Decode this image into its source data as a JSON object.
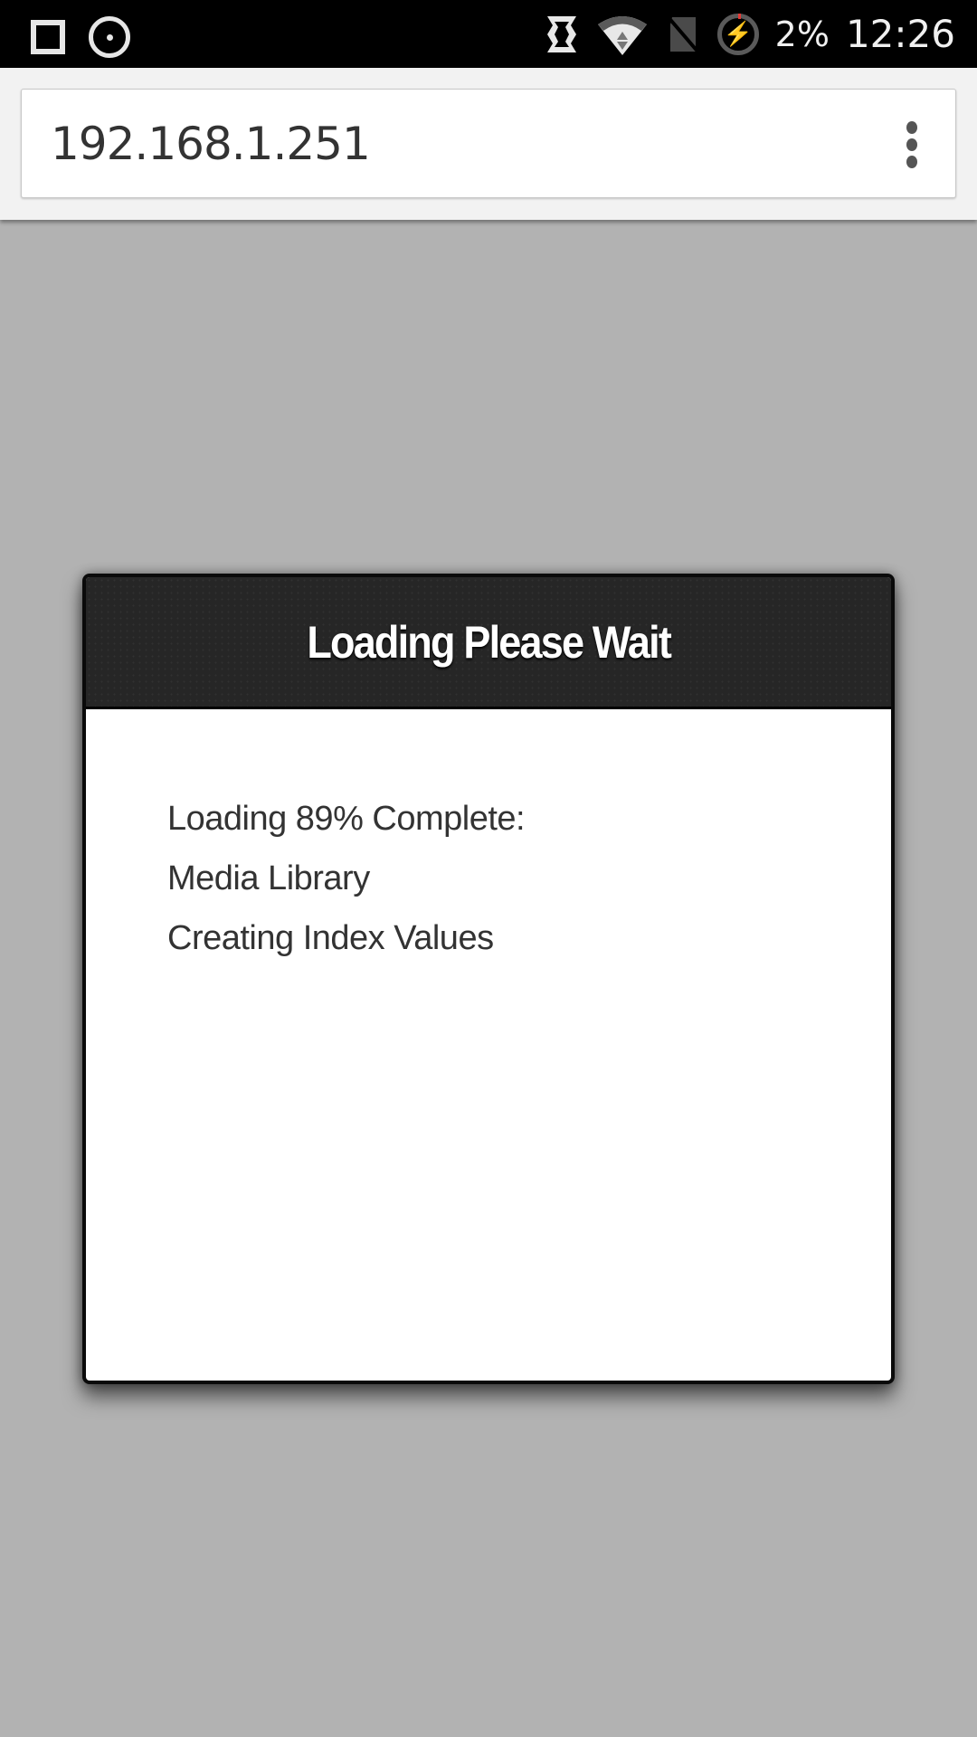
{
  "status_bar": {
    "left_icons": [
      "square-icon",
      "circle-dot-icon"
    ],
    "right_icons": [
      "screen-cast-icon",
      "wifi-icon",
      "no-sim-icon",
      "battery-charging-icon"
    ],
    "battery_percent": "2%",
    "time": "12:26"
  },
  "browser": {
    "url": "192.168.1.251",
    "menu_icon": "overflow-menu-icon"
  },
  "dialog": {
    "title": "Loading Please Wait",
    "progress_percent": 89,
    "lines": [
      "Loading 89% Complete:",
      "Media Library",
      "Creating Index Values"
    ]
  }
}
